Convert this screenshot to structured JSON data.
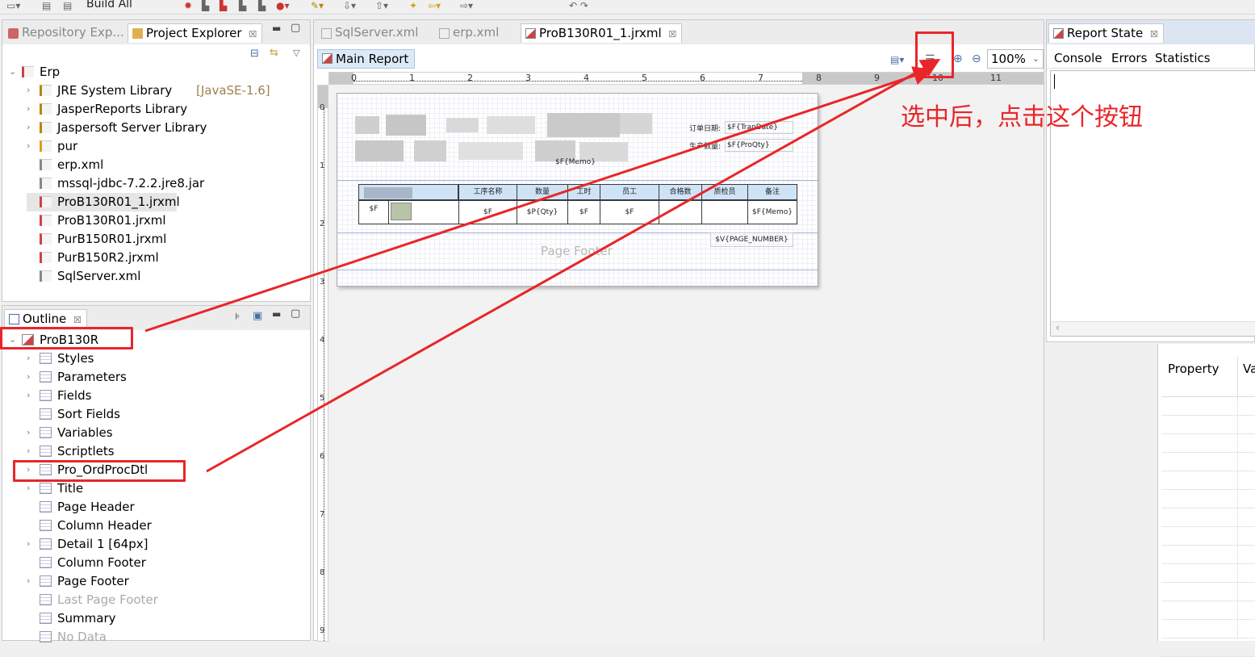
{
  "toolbar": {
    "build_all": "Build All"
  },
  "left_top": {
    "tabs": [
      {
        "label": "Repository Exp..."
      },
      {
        "label": "Project Explorer",
        "close": "☒"
      }
    ],
    "tree": [
      {
        "label": "Erp"
      },
      {
        "label": "JRE System Library",
        "suffix": "[JavaSE-1.6]"
      },
      {
        "label": "JasperReports Library"
      },
      {
        "label": "Jaspersoft Server Library"
      },
      {
        "label": "pur"
      },
      {
        "label": "erp.xml"
      },
      {
        "label": "mssql-jdbc-7.2.2.jre8.jar"
      },
      {
        "label": "ProB130R01_1.jrxml"
      },
      {
        "label": "ProB130R01.jrxml"
      },
      {
        "label": "PurB150R01.jrxml"
      },
      {
        "label": "PurB150R2.jrxml"
      },
      {
        "label": "SqlServer.xml"
      }
    ]
  },
  "outline": {
    "tab_label": "Outline",
    "root": "ProB130R",
    "items": [
      {
        "label": "Styles"
      },
      {
        "label": "Parameters"
      },
      {
        "label": "Fields"
      },
      {
        "label": "Sort Fields"
      },
      {
        "label": "Variables"
      },
      {
        "label": "Scriptlets"
      },
      {
        "label": "Pro_OrdProcDtl"
      },
      {
        "label": "Title"
      },
      {
        "label": "Page Header"
      },
      {
        "label": "Column Header"
      },
      {
        "label": "Detail 1 [64px]"
      },
      {
        "label": "Column Footer"
      },
      {
        "label": "Page Footer"
      },
      {
        "label": "Last Page Footer"
      },
      {
        "label": "Summary"
      },
      {
        "label": "No Data"
      }
    ]
  },
  "editor": {
    "tabs": [
      {
        "label": "SqlServer.xml"
      },
      {
        "label": "erp.xml"
      },
      {
        "label": "ProB130R01_1.jrxml",
        "close": "☒"
      }
    ],
    "main_report": "Main Report",
    "zoom": "100%",
    "ruler_marks": [
      "0",
      "1",
      "2",
      "3",
      "4",
      "5",
      "6",
      "7",
      "8",
      "9",
      "10",
      "11"
    ],
    "vruler_marks": [
      "0",
      "1",
      "2",
      "3",
      "4",
      "5",
      "6",
      "7",
      "8",
      "9"
    ],
    "report": {
      "order_date_label": "订单日期:",
      "order_date_field": "$F{TranDate}",
      "qty_label": "生产数量:",
      "qty_field": "$F{ProQty}",
      "memo_field": "$F{Memo}",
      "headers": [
        "工序名称",
        "数量",
        "工时",
        "员工",
        "合格数",
        "质检员",
        "备注"
      ],
      "row": [
        "$F",
        "$F",
        "$P{Qty}",
        "$F",
        "$F",
        "",
        "",
        "$F{Memo}"
      ],
      "page_footer": "Page Footer",
      "page_number": "$V{PAGE_NUMBER}"
    }
  },
  "annotation": {
    "text": "选中后，点击这个按钮",
    "color": "#e8262a"
  },
  "right": {
    "tab_label": "Report State",
    "subtabs": [
      "Console",
      "Errors",
      "Statistics"
    ],
    "property_header": "Property",
    "value_header": "Va"
  }
}
